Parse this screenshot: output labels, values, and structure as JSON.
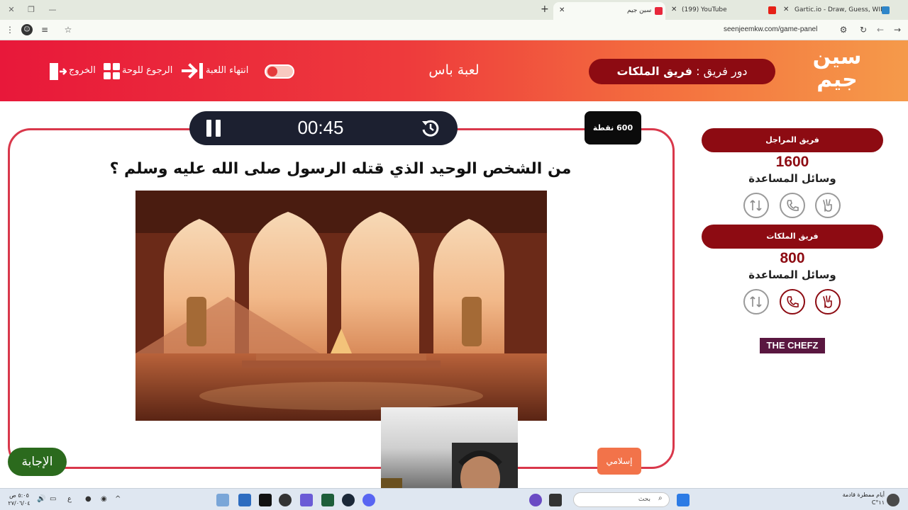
{
  "browser": {
    "tabs": [
      {
        "label": "Gartic.io - Draw, Guess, WIN",
        "favicon_color": "#2f86c9"
      },
      {
        "label": "(199) YouTube",
        "favicon_color": "#e62117"
      },
      {
        "label": "سين جيم",
        "favicon_color": "#e8283c",
        "active": true
      }
    ],
    "url": "seenjeemkw.com/game-panel"
  },
  "header": {
    "logo_text_top": "سين",
    "logo_text_bottom": "جيم",
    "turn_prefix": "دور فريق :",
    "turn_team": "فريق الملكات",
    "game_name": "لعبة باس",
    "end_game_label": "انتهاء اللعبة",
    "back_label": "الرجوع للوحة",
    "exit_label": "الخروج"
  },
  "question": {
    "timer": "00:45",
    "points": "600 نقطة",
    "text": "من الشخص الوحيد الذي قتله الرسول صلى الله عليه وسلم ؟",
    "category": "إسلامي",
    "answer_label": "الإجابة"
  },
  "teams": [
    {
      "name": "فريق المراجل",
      "score": "1600",
      "aids_label": "وسائل المساعدة",
      "aids": [
        {
          "icon": "peace-hand-icon",
          "on": false
        },
        {
          "icon": "phone-icon",
          "on": false
        },
        {
          "icon": "two-answers-icon",
          "on": false
        }
      ]
    },
    {
      "name": "فريق الملكات",
      "score": "800",
      "aids_label": "وسائل المساعدة",
      "aids": [
        {
          "icon": "peace-hand-icon",
          "on": true
        },
        {
          "icon": "phone-icon",
          "on": true
        },
        {
          "icon": "two-answers-icon",
          "on": false
        }
      ]
    }
  ],
  "sponsor": "THE CHEFZ",
  "taskbar": {
    "search_placeholder": "بحث",
    "weather_line1": "أيام ممطرة قادمة",
    "weather_line2": "١١°C",
    "clock_line1": "٥:٠٥ ص",
    "clock_line2": "٢٧/٠٦/٠٤",
    "lang": "ع"
  },
  "colors": {
    "accent": "#8d0b12",
    "card_border": "#d9384b",
    "answer": "#2b6a1d",
    "category": "#f2734a"
  }
}
